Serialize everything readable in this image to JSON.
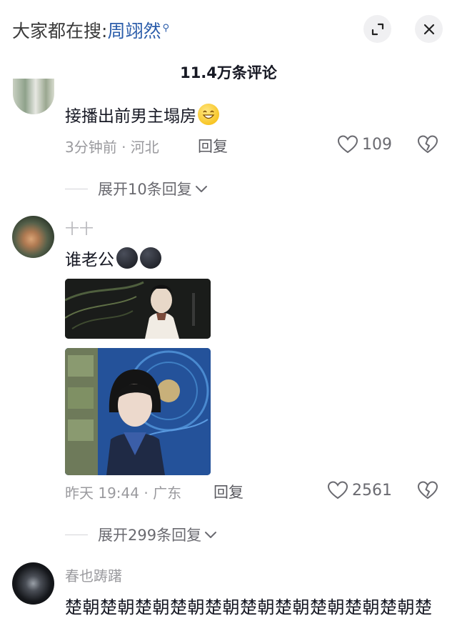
{
  "header": {
    "search_prefix": "大家都在搜:",
    "search_keyword": "周翊然",
    "comment_count": "11.4万条评论"
  },
  "comments": [
    {
      "text": "接播出前男主塌房",
      "time_location": "3分钟前 · 河北",
      "reply_label": "回复",
      "likes": "109",
      "expand_label": "展开10条回复"
    },
    {
      "username": "十十",
      "text": "谁老公",
      "time_location": "昨天 19:44 · 广东",
      "reply_label": "回复",
      "likes": "2561",
      "expand_label": "展开299条回复"
    },
    {
      "username": "春也踌躇",
      "text": "楚朝楚朝楚朝楚朝楚朝楚朝楚朝楚朝楚朝楚朝楚"
    }
  ],
  "icons": {
    "search_hint": "magnifier-icon",
    "expand": "expand-icon",
    "close": "close-icon",
    "like": "heart-outline-icon",
    "dislike": "broken-heart-icon",
    "chevron": "chevron-down-icon"
  },
  "colors": {
    "keyword": "#2a5caa",
    "meta": "#9a9a9e",
    "text": "#161823"
  }
}
